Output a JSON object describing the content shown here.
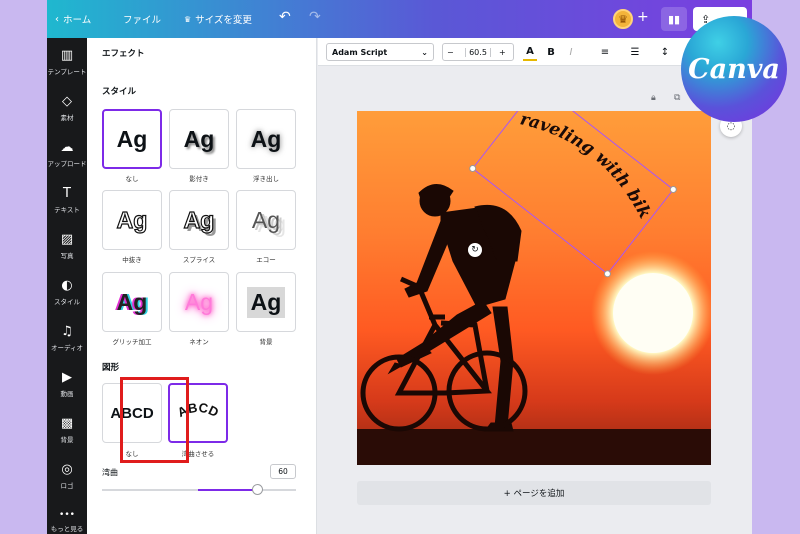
{
  "topbar": {
    "home": "ホーム",
    "file": "ファイル",
    "resize": "サイズを変更"
  },
  "rail": [
    {
      "label": "テンプレート",
      "icon": "template-icon",
      "glyph": "▥"
    },
    {
      "label": "素材",
      "icon": "elements-icon",
      "glyph": "◇"
    },
    {
      "label": "アップロード",
      "icon": "upload-icon",
      "glyph": "☁"
    },
    {
      "label": "テキスト",
      "icon": "text-icon",
      "glyph": "T"
    },
    {
      "label": "写真",
      "icon": "photo-icon",
      "glyph": "▨"
    },
    {
      "label": "スタイル",
      "icon": "palette-icon",
      "glyph": "◐"
    },
    {
      "label": "オーディオ",
      "icon": "audio-icon",
      "glyph": "♫"
    },
    {
      "label": "動画",
      "icon": "video-icon",
      "glyph": "▶"
    },
    {
      "label": "背景",
      "icon": "background-icon",
      "glyph": "▩"
    },
    {
      "label": "ロゴ",
      "icon": "logo-icon",
      "glyph": "◎"
    },
    {
      "label": "もっと見る",
      "icon": "more-icon",
      "glyph": "•••"
    }
  ],
  "panel": {
    "title": "エフェクト",
    "style_heading": "スタイル",
    "shape_heading": "図形",
    "styles": [
      {
        "sample": "Ag",
        "label": "なし"
      },
      {
        "sample": "Ag",
        "label": "影付き"
      },
      {
        "sample": "Ag",
        "label": "浮き出し"
      },
      {
        "sample": "Ag",
        "label": "中抜き"
      },
      {
        "sample": "Ag",
        "label": "スプライス"
      },
      {
        "sample": "Ag",
        "label": "エコー"
      },
      {
        "sample": "Ag",
        "label": "グリッチ加工"
      },
      {
        "sample": "Ag",
        "label": "ネオン"
      },
      {
        "sample": "Ag",
        "label": "背景"
      }
    ],
    "shapes": [
      {
        "sample": "ABCD",
        "label": "なし"
      },
      {
        "sample": "ABCD",
        "label": "湾曲させる"
      }
    ],
    "curve_label": "湾曲",
    "curve_value": "60",
    "curve_level": 0.8
  },
  "toolbar": {
    "font": "Adam Script",
    "size": "60.5",
    "minus": "−",
    "plus": "+",
    "bold": "B",
    "italic": "I"
  },
  "canvas": {
    "curved_text": "Traveling with bike"
  },
  "add_page": "+ ページを追加",
  "brand": "Canva",
  "colors": {
    "accent": "#7d2ae8",
    "highlight": "#e01c1c"
  }
}
